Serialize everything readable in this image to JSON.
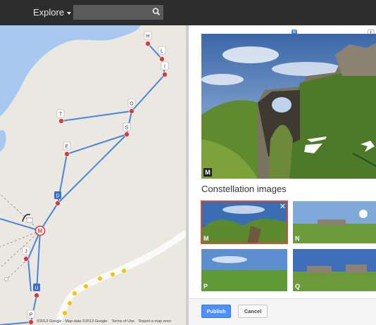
{
  "topbar": {
    "explore_label": "Explore",
    "search_placeholder": ""
  },
  "map": {
    "pins": {
      "H": "H",
      "L": "L",
      "I": "I",
      "O": "O",
      "T": "T",
      "S": "S",
      "E": "E",
      "D": "D",
      "M": "M",
      "J": "J",
      "U": "U",
      "P": "P"
    },
    "attribution": {
      "copyright": "©2013 Google - Map data ©2013 Google",
      "terms": "Terms of Use",
      "report": "Report a map error"
    }
  },
  "panel": {
    "viewer_label": "M",
    "top_markers": [
      "R",
      "F"
    ],
    "heading": "Constellation images",
    "thumbnails": [
      {
        "label": "M",
        "selected": true
      },
      {
        "label": "N",
        "selected": false
      },
      {
        "label": "P",
        "selected": false
      },
      {
        "label": "Q",
        "selected": false
      }
    ],
    "close_symbol": "✕",
    "publish_label": "Publish",
    "cancel_label": "Cancel"
  },
  "colors": {
    "accent": "#4d90fe",
    "selected_outline": "#dd4b39",
    "route": "#4a86d8",
    "pin": "#d63a3a",
    "water": "#a8c8f0"
  }
}
